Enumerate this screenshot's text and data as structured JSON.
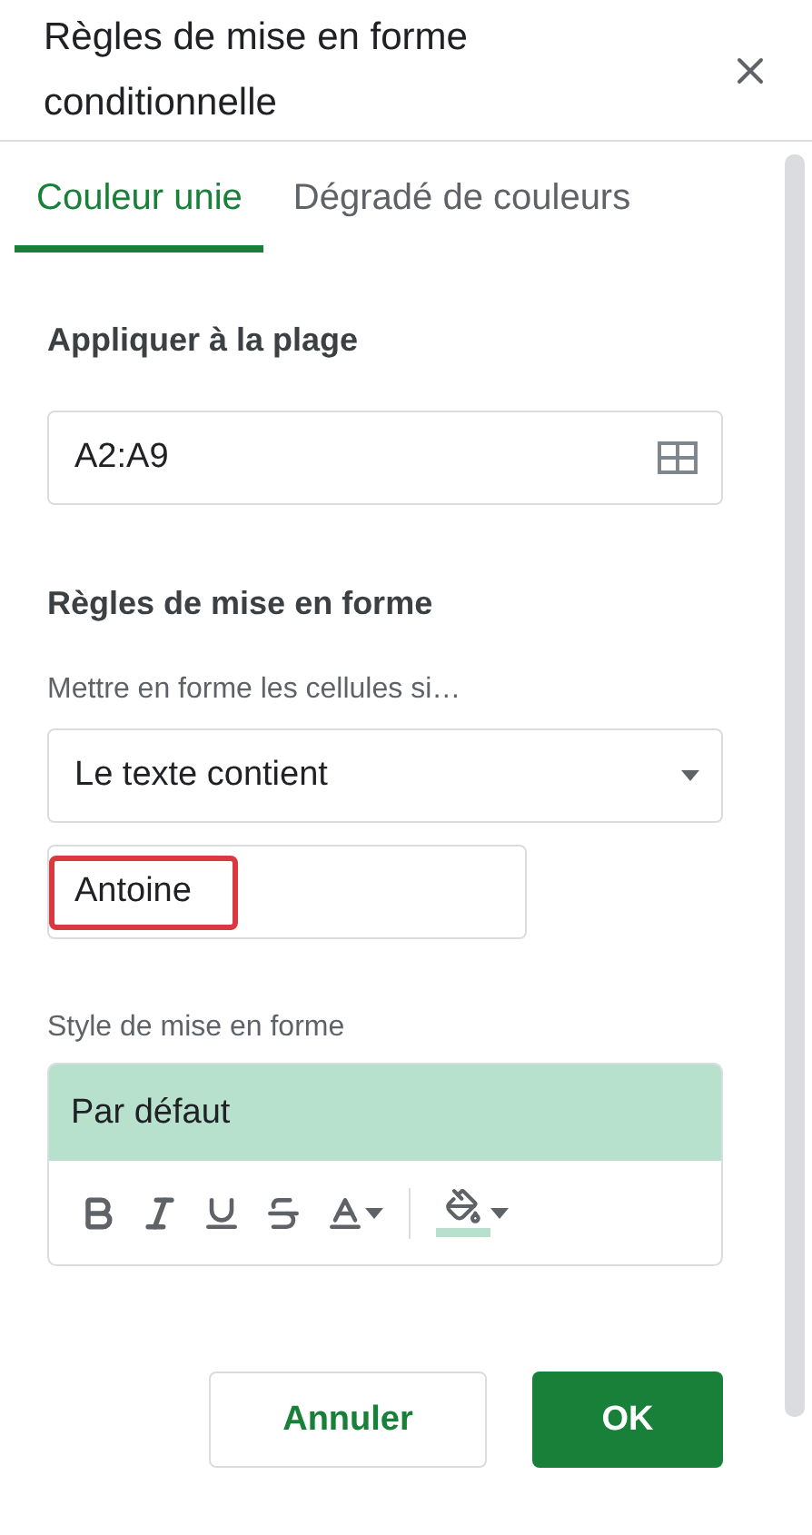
{
  "title": "Règles de mise en forme conditionnelle",
  "tabs": [
    {
      "label": "Couleur unie",
      "selected": true
    },
    {
      "label": "Dégradé de couleurs",
      "selected": false
    }
  ],
  "range": {
    "heading": "Appliquer à la plage",
    "value": "A2:A9"
  },
  "rules": {
    "heading": "Règles de mise en forme",
    "condition_label": "Mettre en forme les cellules si…",
    "condition": "Le texte contient",
    "value": "Antoine",
    "value_highlighted": true
  },
  "style": {
    "label": "Style de mise en forme",
    "preview": "Par défaut"
  },
  "buttons": [
    {
      "label": "Annuler",
      "kind": "secondary"
    },
    {
      "label": "OK",
      "kind": "primary"
    }
  ]
}
